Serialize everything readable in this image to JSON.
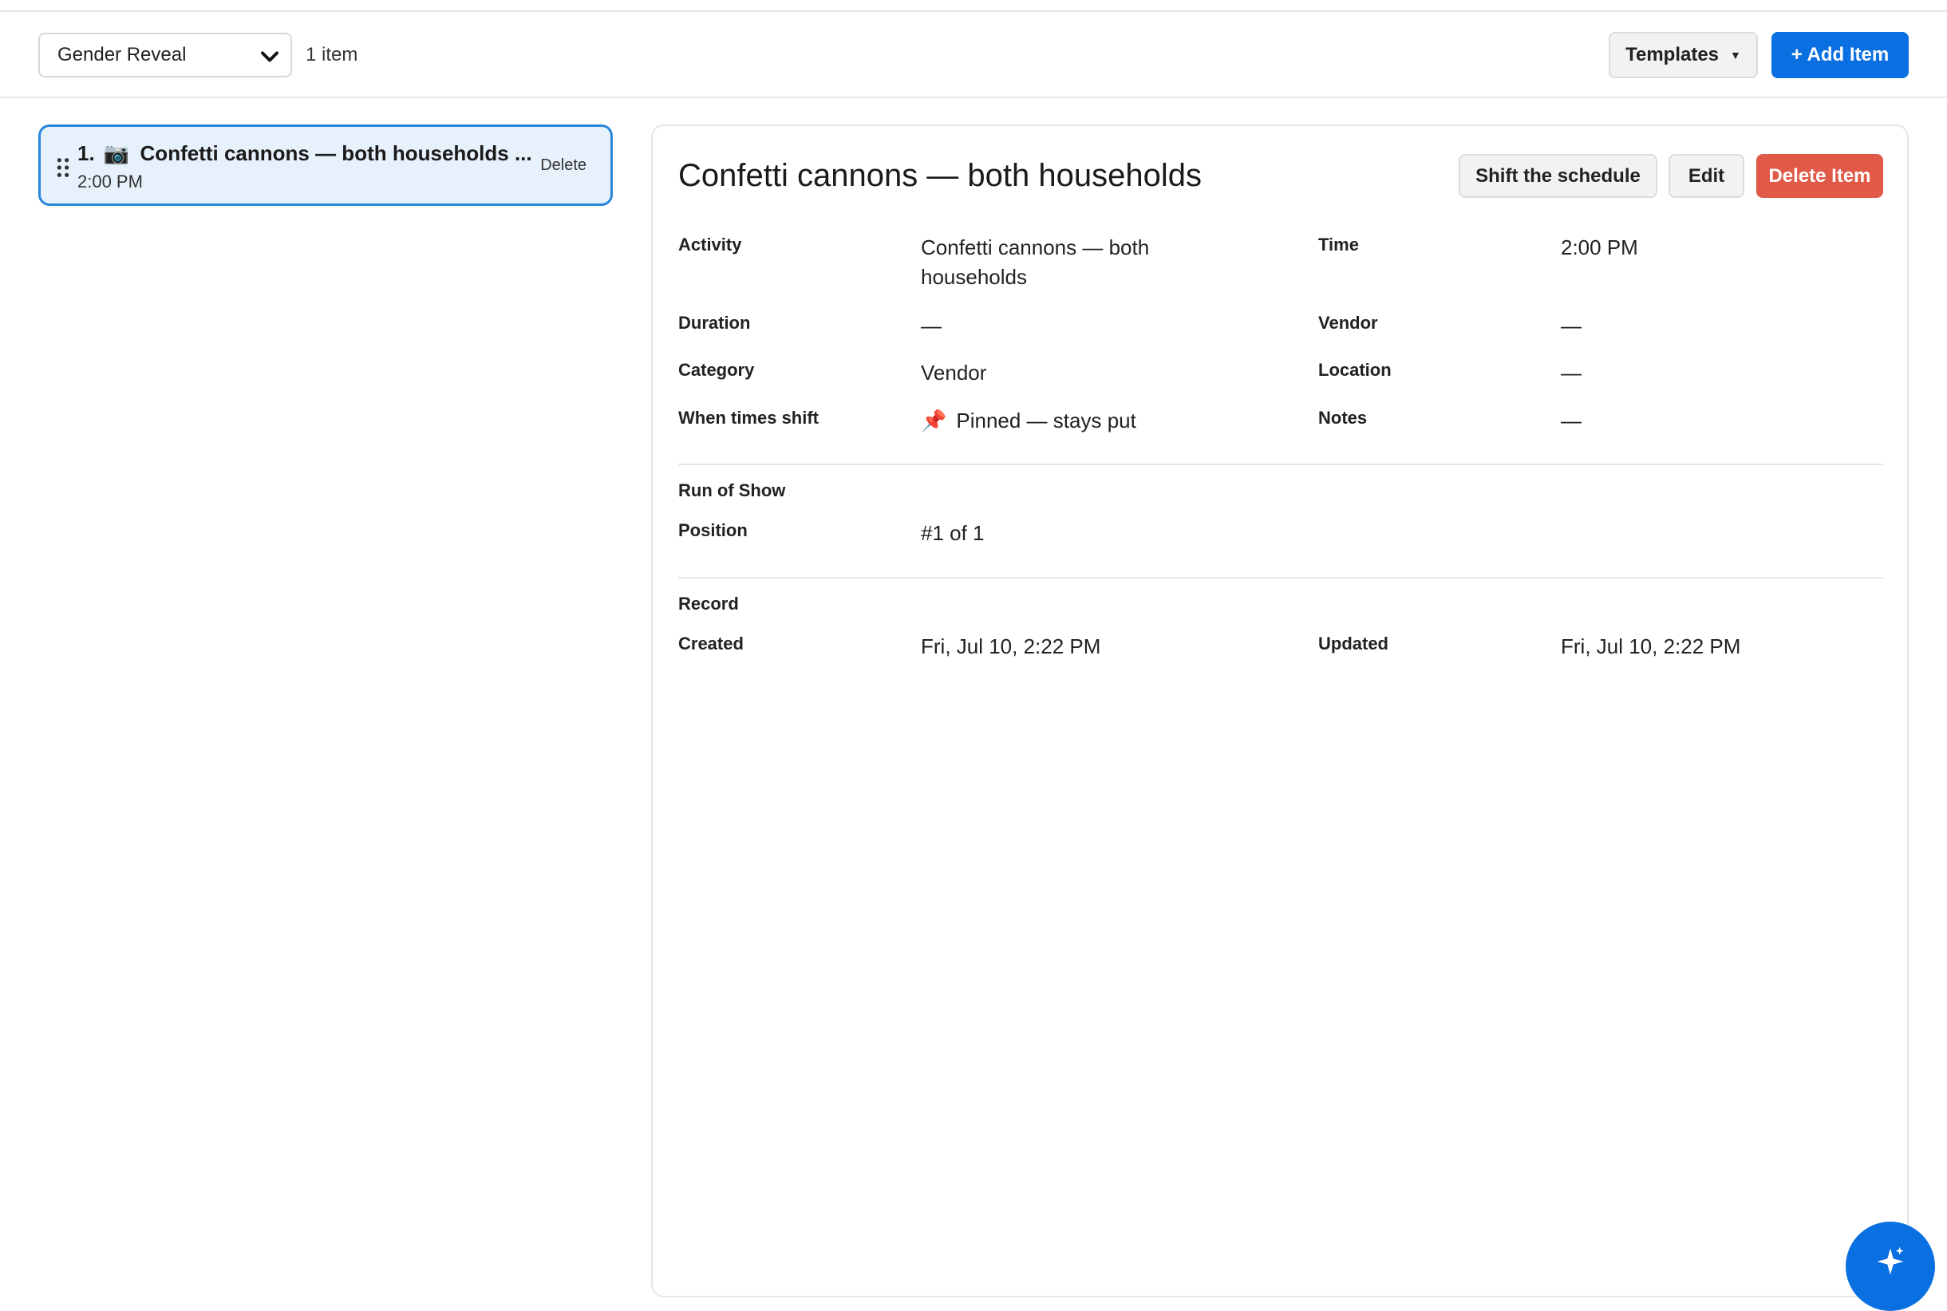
{
  "toolbar": {
    "event_select_value": "Gender Reveal",
    "item_count": "1 item",
    "templates_label": "Templates",
    "add_item_label": "+ Add Item"
  },
  "list": {
    "items": [
      {
        "number": "1.",
        "emoji": "📷",
        "title": "Confetti cannons — both households ...",
        "time": "2:00 PM",
        "delete_label": "Delete"
      }
    ]
  },
  "detail": {
    "title": "Confetti cannons — both households",
    "buttons": {
      "shift": "Shift the schedule",
      "edit": "Edit",
      "delete": "Delete Item"
    },
    "fields": {
      "activity_label": "Activity",
      "activity_value_line1": "Confetti cannons — both",
      "activity_value_line2": "households",
      "time_label": "Time",
      "time_value": "2:00 PM",
      "duration_label": "Duration",
      "duration_value": "—",
      "vendor_label": "Vendor",
      "vendor_value": "—",
      "category_label": "Category",
      "category_value": "Vendor",
      "location_label": "Location",
      "location_value": "—",
      "shift_label": "When times shift",
      "shift_icon": "📌",
      "shift_value": "Pinned — stays put",
      "notes_label": "Notes",
      "notes_value": "—"
    },
    "run_of_show": {
      "heading": "Run of Show",
      "position_label": "Position",
      "position_value": "#1 of 1"
    },
    "record": {
      "heading": "Record",
      "created_label": "Created",
      "created_value": "Fri, Jul 10, 2:22 PM",
      "updated_label": "Updated",
      "updated_value": "Fri, Jul 10, 2:22 PM"
    }
  },
  "colors": {
    "primary": "#0a6fe0",
    "danger": "#e05a47",
    "selected_bg": "#e7f1fb",
    "selected_border": "#2a86db"
  },
  "icons": {
    "select_chevron": "chevron-down-icon",
    "templates_caret": "caret-down-icon",
    "drag": "drag-handle-icon",
    "fab": "sparkle-icon"
  }
}
